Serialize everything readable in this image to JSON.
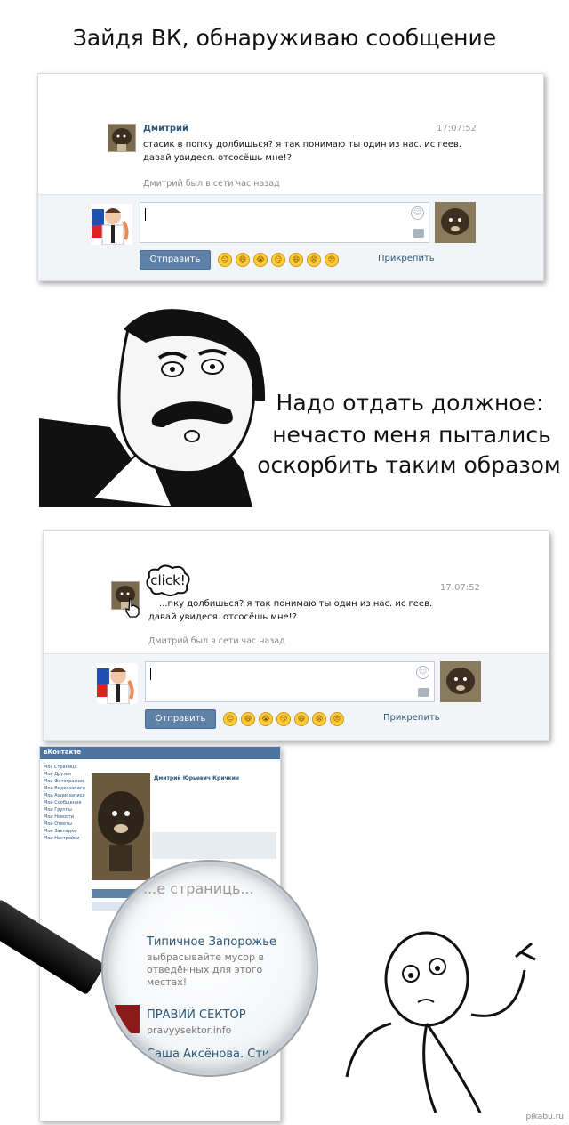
{
  "captions": {
    "top": "Зайдя ВК, обнаруживаю сообщение",
    "middle_lines": [
      "Надо отдать должное:",
      "нечасто меня пытались",
      "оскорбить таким образом"
    ]
  },
  "message": {
    "sender": "Дмитрий",
    "time": "17:07:52",
    "lines": [
      "стасик в попку долбишься? я так понимаю ты один из нас. ис геев.",
      "давай увидеся. отсосёшь мне!?"
    ],
    "lines_covered": [
      "...пку долбишься? я так понимаю ты один из нас. ис геев.",
      "давай увидеся. отсосёшь мне!?"
    ],
    "seen": "Дмитрий был в сети час назад"
  },
  "compose": {
    "send_label": "Отправить",
    "attach_label": "Прикрепить",
    "emoji": [
      "😐",
      "😄",
      "😭",
      "😏",
      "😆",
      "😫",
      "😠"
    ]
  },
  "click_label": "click!",
  "profile": {
    "logo": "вКонтакте",
    "name": "Дмитрий Юрьевич Кричкин",
    "nav": [
      "Моя Страница",
      "Мои Друзья",
      "Мои Фотографии",
      "Мои Видеозаписи",
      "Мои Аудиозаписи",
      "Мои Сообщения",
      "Мои Группы",
      "Мои Новости",
      "Мои Ответы",
      "Мои Закладки",
      "Мои Настройки"
    ]
  },
  "magnifier": {
    "header": "...е страниць...",
    "items": [
      {
        "title": "Типичное Запорожье",
        "sub": [
          "выбрасывайте мусор в",
          "отведённых для этого",
          "местах!"
        ]
      },
      {
        "title": "ПРАВИЙ СЕКТОР",
        "sub": [
          "pravyysektor.info"
        ]
      },
      {
        "title": "Саша Аксёнова. Стих...",
        "sub": []
      }
    ]
  },
  "watermark": "pikabu.ru"
}
